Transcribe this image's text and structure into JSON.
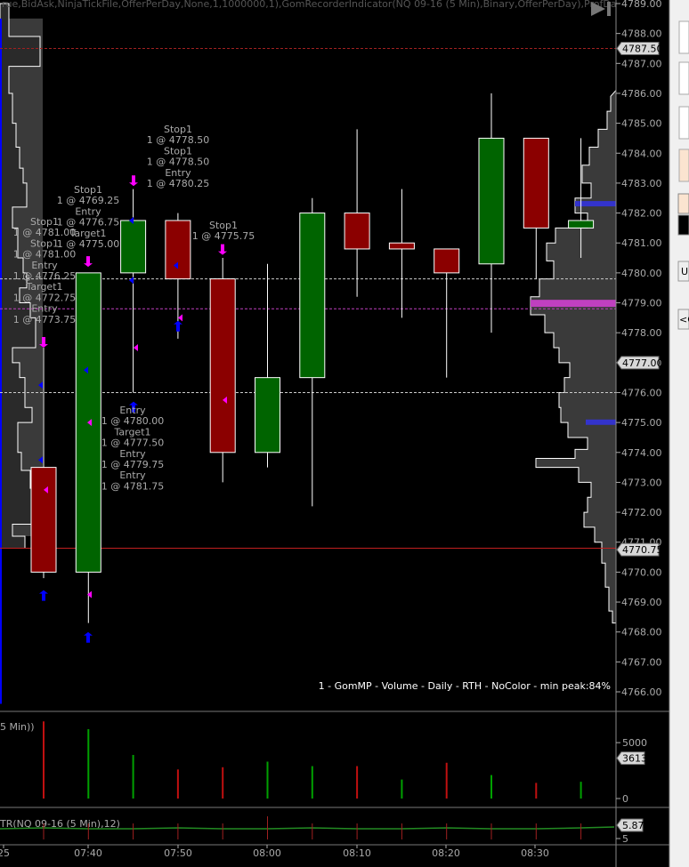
{
  "header_text": "rue,BidAsk,NinjaTickFile,OfferPerDay,None,1,1000000,1),GomRecorderIndicator(NQ 09-16 (5 Min),Binary,OfferPerDay),ProfDayOf...",
  "profile_caption": "1 - GomMP  - Volume - Daily - RTH - NoColor - min peak:84%",
  "volume_caption": "5 Min))",
  "atr_caption": "TR(NQ 09-16 (5 Min),12)",
  "right_panel_labels": [
    "U",
    "<C"
  ],
  "colors": {
    "up": "#006400",
    "down": "#8b0000",
    "buy_arrow": "#0000ff",
    "sell_arrow": "#ff00ff",
    "profile": "#3a3a3a",
    "marker": "#c040c0"
  },
  "chart_data": {
    "type": "candlestick",
    "y_axis_price": {
      "min": 4766,
      "max": 4789,
      "ticks": [
        "4789.00",
        "4788.00",
        "4787.00",
        "4786.00",
        "4785.00",
        "4784.00",
        "4783.00",
        "4782.00",
        "4781.00",
        "4780.00",
        "4779.00",
        "4778.00",
        "4777.00",
        "4776.00",
        "4775.00",
        "4774.00",
        "4773.00",
        "4772.00",
        "4771.00",
        "4770.00",
        "4769.00",
        "4768.00",
        "4767.00",
        "4766.00"
      ]
    },
    "price_flags": [
      {
        "label": "4787.50",
        "value": 4787.5
      },
      {
        "label": "4777.00",
        "value": 4777.0
      },
      {
        "label": "4770.75",
        "value": 4770.75
      }
    ],
    "x_labels": [
      "25",
      "07:40",
      "07:50",
      "08:00",
      "08:10",
      "08:20",
      "08:30"
    ],
    "candles": [
      {
        "open": 4773.5,
        "high": 4777.5,
        "low": 4769.8,
        "close": 4770.0
      },
      {
        "open": 4770.0,
        "high": 4780.0,
        "low": 4768.3,
        "close": 4780.0
      },
      {
        "open": 4780.0,
        "high": 4782.8,
        "low": 4776.0,
        "close": 4781.75
      },
      {
        "open": 4781.75,
        "high": 4782.0,
        "low": 4777.8,
        "close": 4779.8
      },
      {
        "open": 4779.8,
        "high": 4780.5,
        "low": 4773.0,
        "close": 4774.0
      },
      {
        "open": 4774.0,
        "high": 4780.3,
        "low": 4773.5,
        "close": 4776.5
      },
      {
        "open": 4776.5,
        "high": 4782.5,
        "low": 4772.2,
        "close": 4782.0
      },
      {
        "open": 4782.0,
        "high": 4784.8,
        "low": 4779.2,
        "close": 4780.8
      },
      {
        "open": 4781.0,
        "high": 4782.8,
        "low": 4778.5,
        "close": 4780.8
      },
      {
        "open": 4780.8,
        "high": 4780.8,
        "low": 4776.5,
        "close": 4780.0
      },
      {
        "open": 4780.3,
        "high": 4786.0,
        "low": 4778.0,
        "close": 4784.5
      },
      {
        "open": 4784.5,
        "high": 4784.5,
        "low": 4779.8,
        "close": 4781.5
      },
      {
        "open": 4781.5,
        "high": 4784.5,
        "low": 4780.5,
        "close": 4781.75
      }
    ],
    "annotations": [
      {
        "lines": [
          "Stop1",
          "1 @ 4781.00",
          "Stop1",
          "1 @ 4781.00",
          "Entry",
          "1 @ 4776.25",
          "Target1",
          "1 @ 4772.75",
          "Entry",
          "1 @ 4773.75"
        ],
        "bar": 0
      },
      {
        "lines": [
          "Stop1",
          "1 @ 4769.25",
          "Entry",
          "1 @ 4776.75",
          "Target1",
          "1 @ 4775.00"
        ],
        "bar": 1
      },
      {
        "lines": [
          "Entry",
          "1 @ 4780.00",
          "Target1",
          "1 @ 4777.50",
          "Entry",
          "1 @ 4779.75",
          "Entry",
          "1 @ 4781.75"
        ],
        "bar": 1
      },
      {
        "lines": [
          "Stop1",
          "1 @ 4778.50",
          "Stop1",
          "1 @ 4778.50",
          "Entry",
          "1 @ 4780.25"
        ],
        "bar": 3
      },
      {
        "lines": [
          "Stop1",
          "1 @ 4775.75"
        ],
        "bar": 4
      }
    ],
    "volume": {
      "ticks": [
        "5000",
        "0"
      ],
      "max": 7000,
      "current_label": "3613",
      "bars": [
        {
          "v": 6900,
          "up": false
        },
        {
          "v": 6200,
          "up": true
        },
        {
          "v": 3900,
          "up": true
        },
        {
          "v": 2600,
          "up": false
        },
        {
          "v": 2800,
          "up": false
        },
        {
          "v": 3300,
          "up": true
        },
        {
          "v": 2900,
          "up": true
        },
        {
          "v": 2900,
          "up": false
        },
        {
          "v": 1700,
          "up": true
        },
        {
          "v": 3200,
          "up": false
        },
        {
          "v": 2100,
          "up": true
        },
        {
          "v": 1400,
          "up": false
        },
        {
          "v": 1500,
          "up": true
        }
      ]
    },
    "atr": {
      "ticks": [
        "5"
      ],
      "current_label": "5.87",
      "value": 5.87
    }
  }
}
